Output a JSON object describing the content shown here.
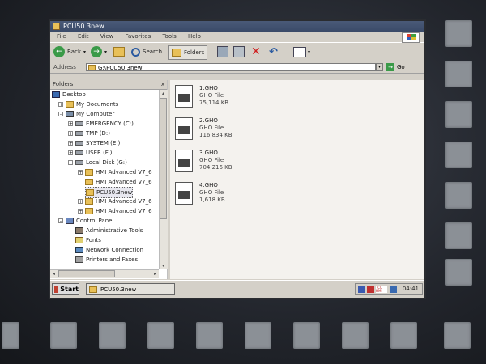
{
  "window": {
    "title": "PCU50.3new"
  },
  "menu": [
    "File",
    "Edit",
    "View",
    "Favorites",
    "Tools",
    "Help"
  ],
  "toolbar": {
    "back": "Back",
    "search": "Search",
    "folders": "Folders"
  },
  "address": {
    "label": "Address",
    "value": "G:\\PCU50.3new",
    "go": "Go"
  },
  "folders_pane": {
    "title": "Folders",
    "close": "x",
    "items": [
      {
        "label": "Desktop"
      },
      {
        "label": "My Documents"
      },
      {
        "label": "My Computer"
      },
      {
        "label": "EMERGENCY (C:)"
      },
      {
        "label": "TMP (D:)"
      },
      {
        "label": "SYSTEM (E:)"
      },
      {
        "label": "USER (F:)"
      },
      {
        "label": "Local Disk (G:)"
      },
      {
        "label": "HMI Advanced V7_6"
      },
      {
        "label": "HMI Advanced V7_6"
      },
      {
        "label": "PCU50.3new"
      },
      {
        "label": "HMI Advanced V7_6"
      },
      {
        "label": "HMI Advanced V7_6"
      },
      {
        "label": "Control Panel"
      },
      {
        "label": "Administrative Tools"
      },
      {
        "label": "Fonts"
      },
      {
        "label": "Network Connection"
      },
      {
        "label": "Printers and Faxes"
      }
    ]
  },
  "files": [
    {
      "name": "1.GHO",
      "type": "GHO File",
      "size": "75,114 KB"
    },
    {
      "name": "2.GHO",
      "type": "GHO File",
      "size": "116,834 KB"
    },
    {
      "name": "3.GHO",
      "type": "GHO File",
      "size": "704,216 KB"
    },
    {
      "name": "4.GHO",
      "type": "GHO File",
      "size": "1,618 KB"
    }
  ],
  "taskbar": {
    "start": "Start",
    "task": "PCU50.3new",
    "clock": "04:41",
    "tray_text": "TCU\nHMI"
  }
}
